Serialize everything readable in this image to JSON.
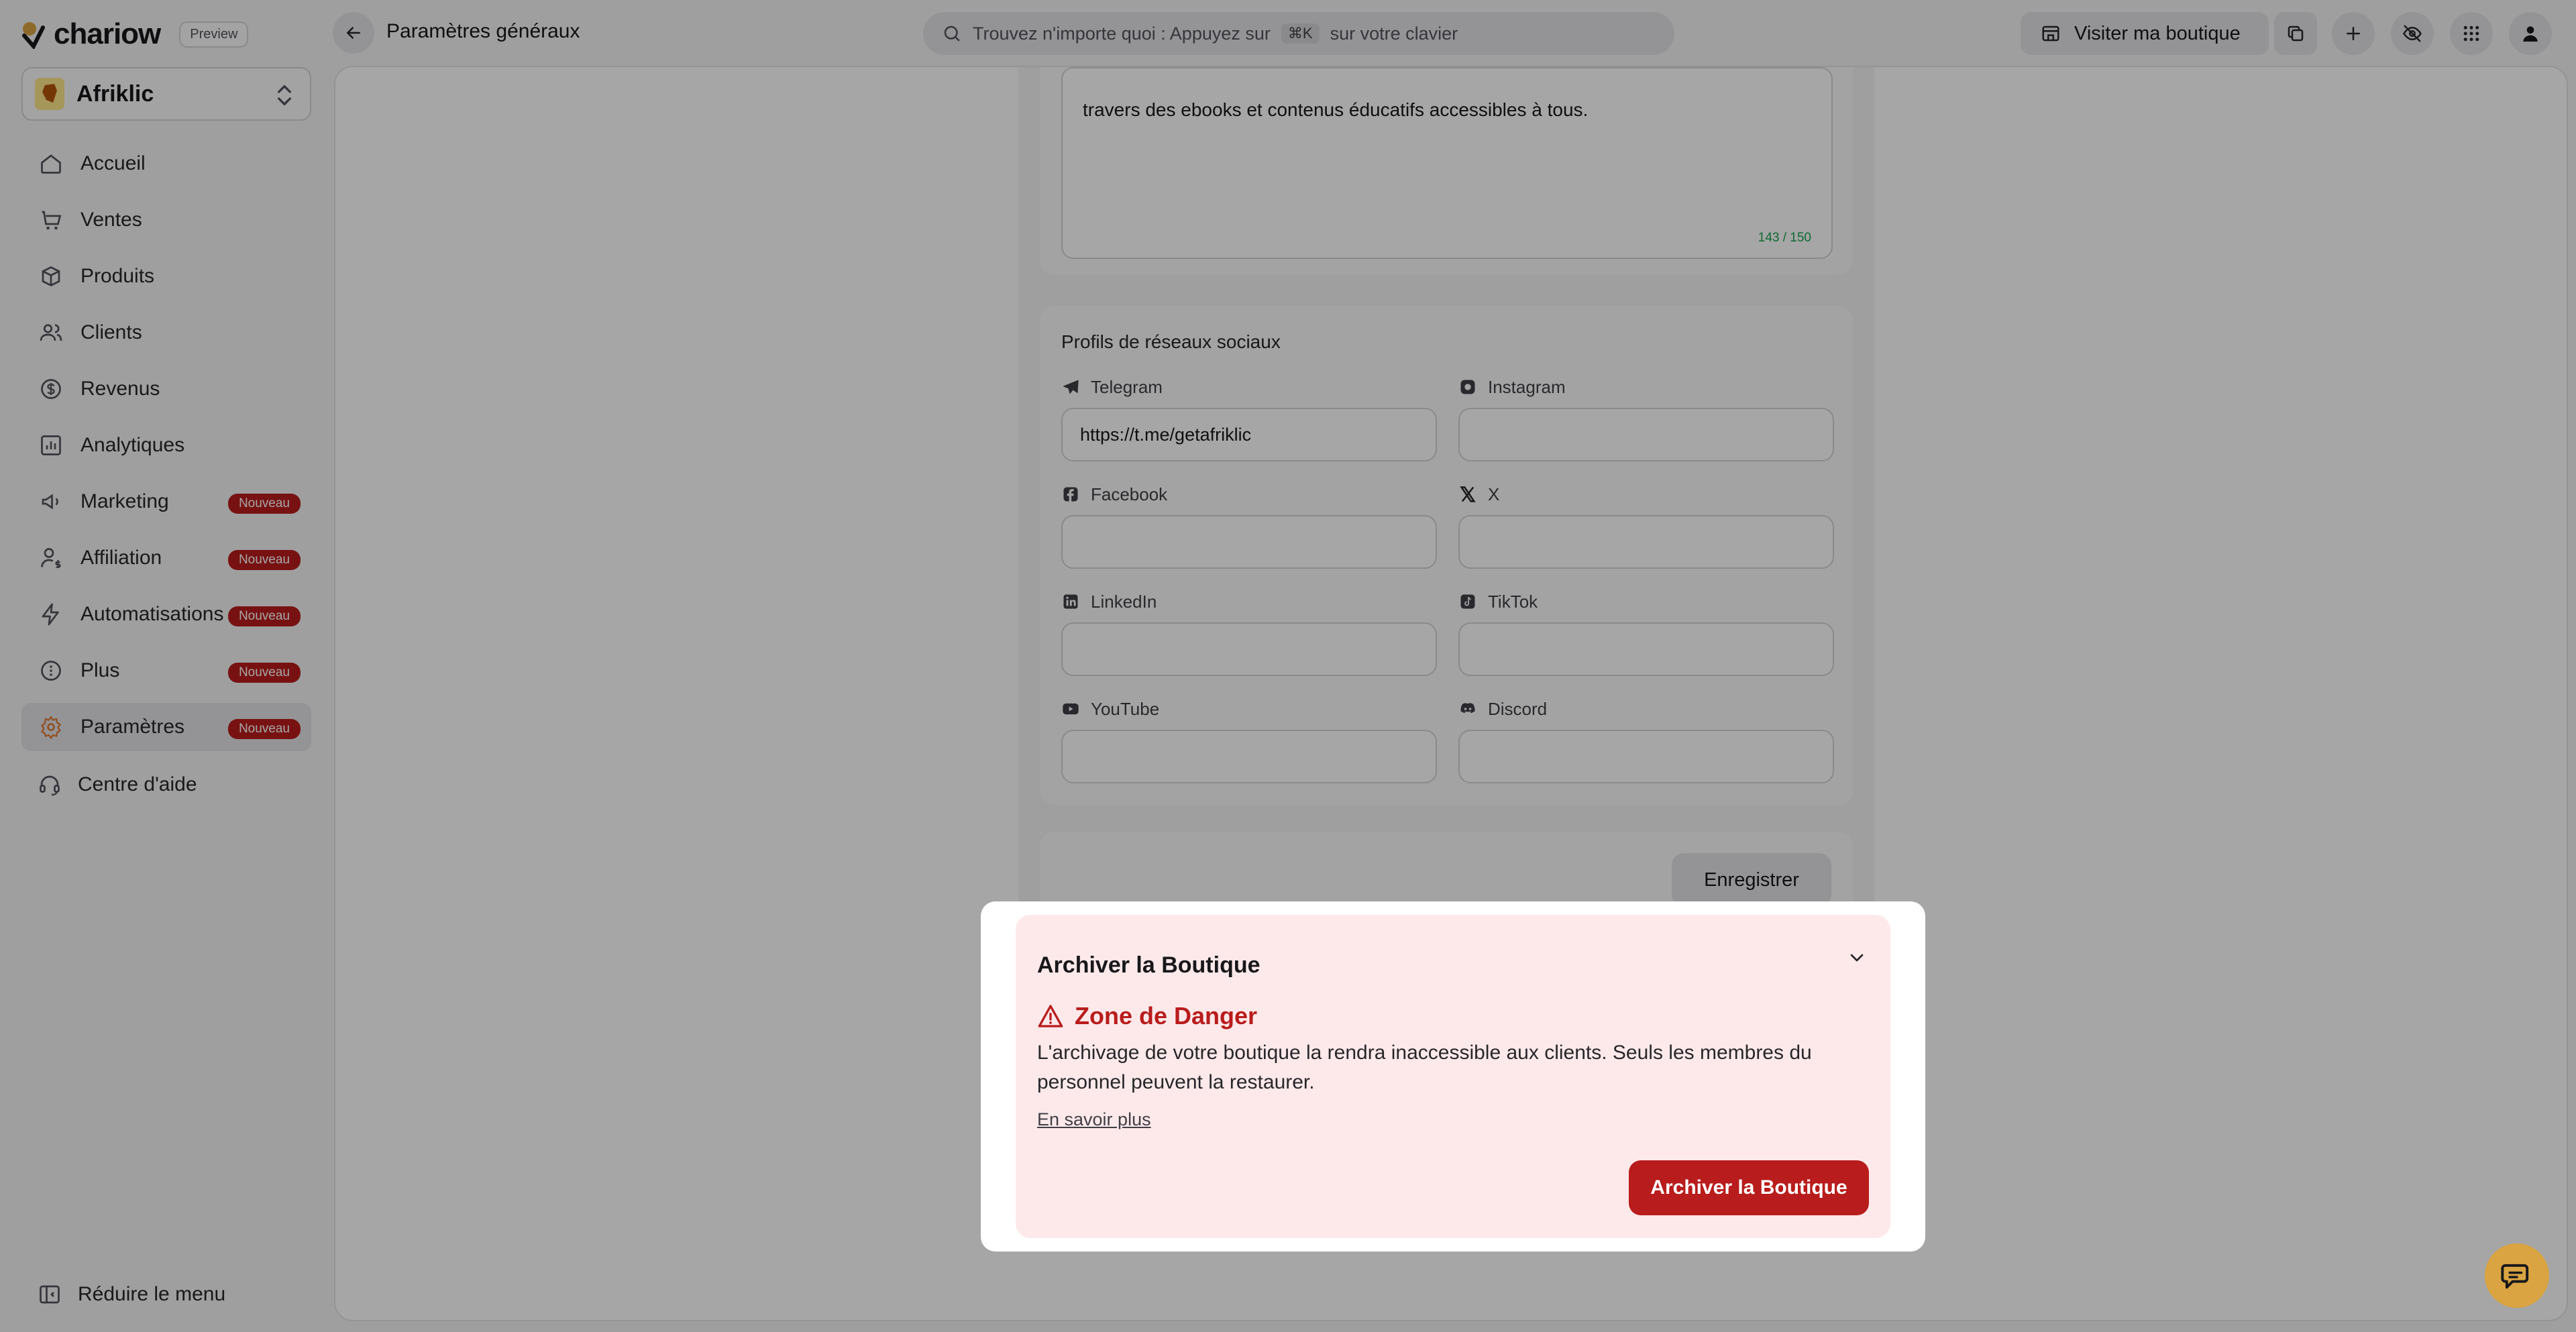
{
  "app": {
    "logo_text": "chariow",
    "preview_badge": "Preview"
  },
  "header": {
    "title": "Paramètres généraux",
    "search_prefix": "Trouvez n'importe quoi : Appuyez sur",
    "search_shortcut": "⌘K",
    "search_suffix": "sur votre clavier",
    "visit_store_label": "Visiter ma boutique"
  },
  "sidebar": {
    "store_name": "Afriklic",
    "items": [
      {
        "label": "Accueil",
        "icon": "home-icon",
        "badge": ""
      },
      {
        "label": "Ventes",
        "icon": "cart-icon",
        "badge": ""
      },
      {
        "label": "Produits",
        "icon": "box-icon",
        "badge": ""
      },
      {
        "label": "Clients",
        "icon": "users-icon",
        "badge": ""
      },
      {
        "label": "Revenus",
        "icon": "dollar-icon",
        "badge": ""
      },
      {
        "label": "Analytiques",
        "icon": "chart-icon",
        "badge": ""
      },
      {
        "label": "Marketing",
        "icon": "megaphone-icon",
        "badge": "Nouveau"
      },
      {
        "label": "Affiliation",
        "icon": "user-dollar-icon",
        "badge": "Nouveau"
      },
      {
        "label": "Automatisations",
        "icon": "bolt-icon",
        "badge": "Nouveau"
      },
      {
        "label": "Plus",
        "icon": "more-icon",
        "badge": "Nouveau"
      },
      {
        "label": "Paramètres",
        "icon": "gear-icon",
        "badge": "Nouveau"
      }
    ],
    "help_label": "Centre d'aide",
    "collapse_label": "Réduire le menu"
  },
  "description": {
    "text_tail": "travers des ebooks et contenus éducatifs accessibles à tous.",
    "counter": "143 / 150"
  },
  "social": {
    "title": "Profils de réseaux sociaux",
    "fields": {
      "telegram": {
        "label": "Telegram",
        "value": "https://t.me/getafriklic"
      },
      "instagram": {
        "label": "Instagram",
        "value": ""
      },
      "facebook": {
        "label": "Facebook",
        "value": ""
      },
      "x": {
        "label": "X",
        "value": ""
      },
      "linkedin": {
        "label": "LinkedIn",
        "value": ""
      },
      "tiktok": {
        "label": "TikTok",
        "value": ""
      },
      "youtube": {
        "label": "YouTube",
        "value": ""
      },
      "discord": {
        "label": "Discord",
        "value": ""
      }
    },
    "save_label": "Enregistrer"
  },
  "danger": {
    "section_title": "Archiver la Boutique",
    "zone_title": "Zone de Danger",
    "description": "L'archivage de votre boutique la rendra inaccessible aux clients. Seuls les membres du personnel peuvent la restaurer.",
    "learn_more": "En savoir plus",
    "archive_button": "Archiver la Boutique"
  },
  "colors": {
    "danger": "#b91c1c",
    "accent": "#e07b39",
    "counter_ok": "#16a34a"
  }
}
